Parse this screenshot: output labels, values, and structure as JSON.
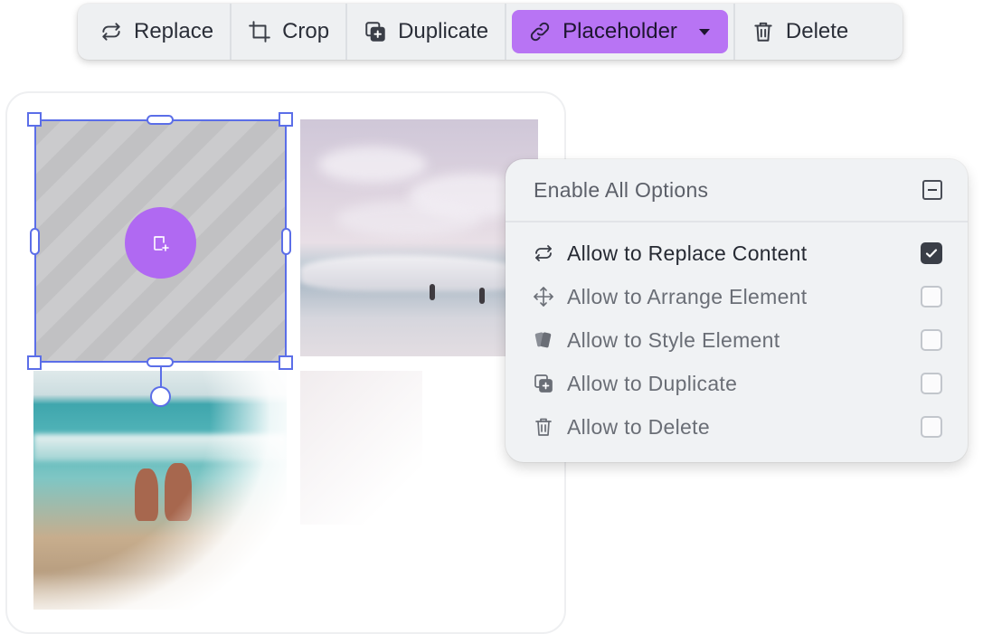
{
  "toolbar": {
    "buttons": [
      {
        "label": "Replace",
        "icon": "replace-icon"
      },
      {
        "label": "Crop",
        "icon": "crop-icon"
      },
      {
        "label": "Duplicate",
        "icon": "duplicate-icon"
      },
      {
        "label": "Placeholder",
        "icon": "link-icon",
        "active": true
      },
      {
        "label": "Delete",
        "icon": "trash-icon"
      }
    ]
  },
  "colors": {
    "accent_purple": "#b874f4",
    "selection_blue": "#5b6ee8",
    "add_circle": "#b069f2"
  },
  "options_panel": {
    "header": "Enable All Options",
    "header_state": "indeterminate",
    "items": [
      {
        "label": "Allow to Replace Content",
        "icon": "replace-icon",
        "checked": true
      },
      {
        "label": "Allow to Arrange Element",
        "icon": "move-arrows-icon",
        "checked": false
      },
      {
        "label": "Allow to Style Element",
        "icon": "style-cards-icon",
        "checked": false
      },
      {
        "label": "Allow to Duplicate",
        "icon": "duplicate-icon",
        "checked": false
      },
      {
        "label": "Allow to Delete",
        "icon": "trash-icon",
        "checked": false
      }
    ]
  }
}
